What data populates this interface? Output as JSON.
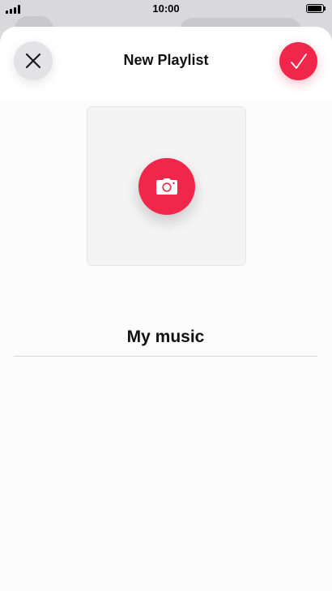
{
  "status_bar": {
    "time": "10:00",
    "signal_icon": "signal-bars-icon",
    "battery_icon": "battery-full-icon",
    "battery_level": 1.0
  },
  "sheet": {
    "title": "New Playlist",
    "close_icon": "close-icon",
    "done_icon": "checkmark-icon",
    "camera_icon": "camera-icon",
    "playlist_name": "My music"
  },
  "colors": {
    "accent": "#f0274a",
    "close_button_bg": "#e3e3e5",
    "sheet_bg": "#fcfcfd",
    "artwork_bg": "#f4f4f5"
  }
}
